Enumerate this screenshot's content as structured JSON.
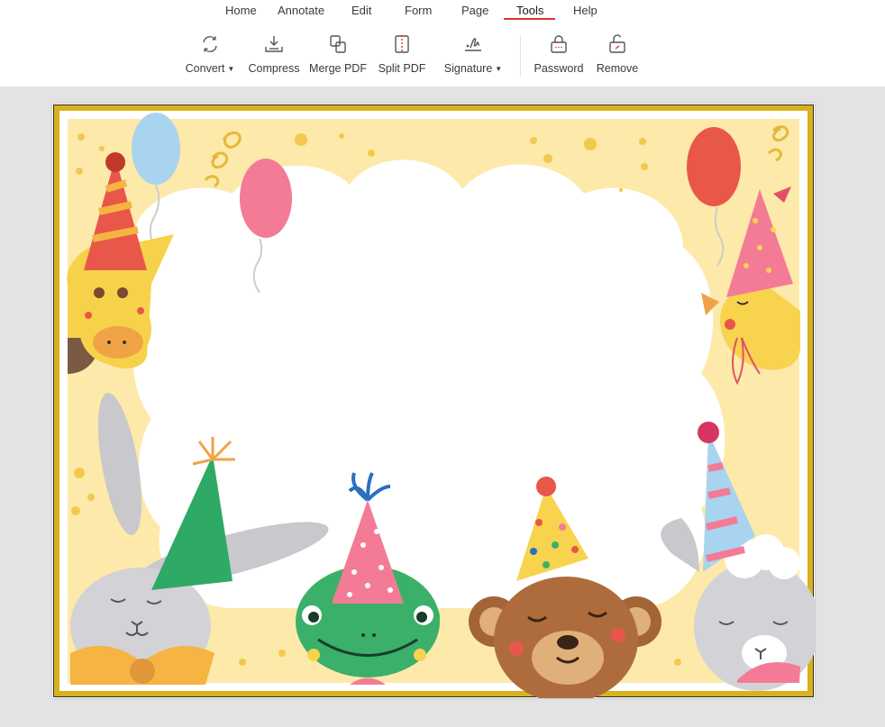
{
  "menu": {
    "items": [
      {
        "label": "Home"
      },
      {
        "label": "Annotate"
      },
      {
        "label": "Edit"
      },
      {
        "label": "Form"
      },
      {
        "label": "Page"
      },
      {
        "label": "Tools"
      },
      {
        "label": "Help"
      }
    ],
    "active": "Tools"
  },
  "tools": {
    "convert": {
      "label": "Convert",
      "icon": "convert-icon"
    },
    "compress": {
      "label": "Compress",
      "icon": "compress-icon"
    },
    "merge": {
      "label": "Merge PDF",
      "icon": "merge-pdf-icon"
    },
    "split": {
      "label": "Split PDF",
      "icon": "split-pdf-icon"
    },
    "signature": {
      "label": "Signature",
      "icon": "signature-icon"
    },
    "password": {
      "label": "Password",
      "icon": "lock-icon"
    },
    "remove": {
      "label": "Remove",
      "icon": "unlock-icon"
    }
  },
  "colors": {
    "accent": "#e0322b",
    "frame_gold": "#d9b11e",
    "frame_cream": "#fde9a9"
  }
}
